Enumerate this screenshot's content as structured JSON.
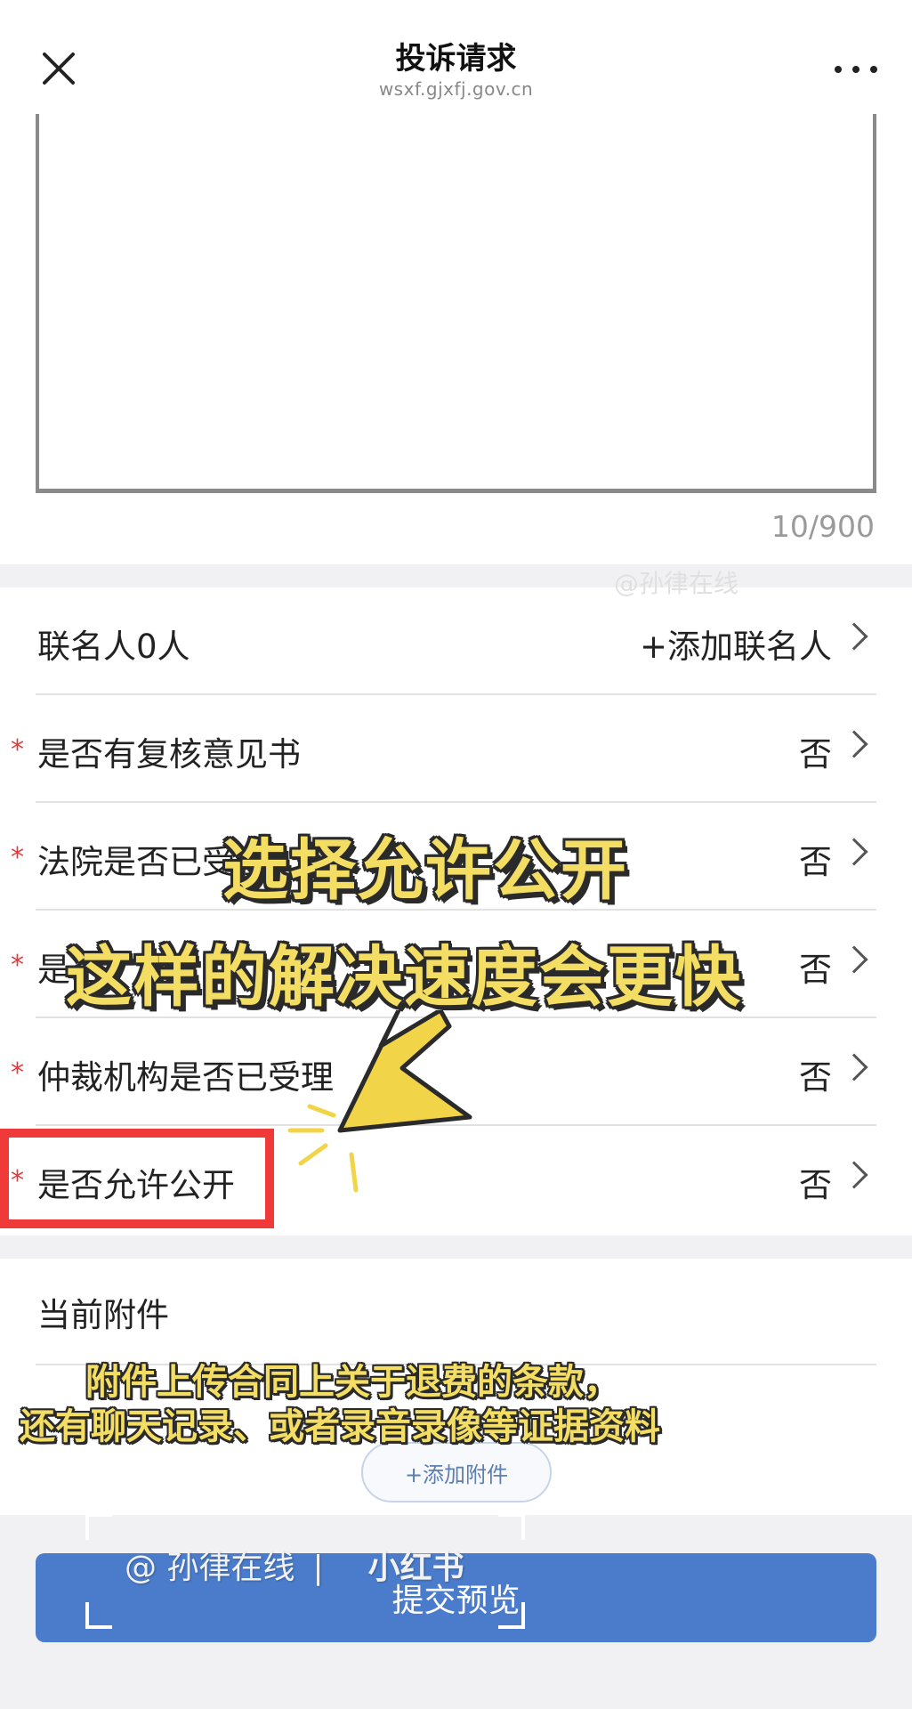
{
  "header": {
    "title": "投诉请求",
    "domain": "wsxf.gjxfj.gov.cn",
    "close_icon": "close-icon",
    "more_icon": "more-dots-icon"
  },
  "textarea": {
    "counter": "10/900"
  },
  "watermark_top": "@孙律在线",
  "form": {
    "cosigners": {
      "label": "联名人0人",
      "action": "+添加联名人"
    },
    "rows": [
      {
        "label": "是否有复核意见书",
        "value": "否",
        "required": true
      },
      {
        "label": "法院是否已受理",
        "value": "否",
        "required": true
      },
      {
        "label": "是否",
        "value": "否",
        "required": true
      },
      {
        "label": "仲裁机构是否已受理",
        "value": "否",
        "required": true
      },
      {
        "label": "是否允许公开",
        "value": "否",
        "required": true
      }
    ],
    "required_mark": "*"
  },
  "attachments": {
    "title": "当前附件",
    "add_button": "+添加附件"
  },
  "submit_button": "提交预览",
  "overlay": {
    "caption_line1": "选择允许公开",
    "caption_line2": "这样的解决速度会更快",
    "caption_line3": "附件上传合同上关于退费的条款，",
    "caption_line4": "还有聊天记录、或者录音录像等证据资料"
  },
  "bottom_watermark": {
    "account": "@ 孙律在线",
    "separator": "|",
    "brand": "小红书"
  },
  "colors": {
    "accent": "#4a7ccb",
    "required": "#e23b3b",
    "highlight_box": "#f03a3a",
    "caption": "#f3de63"
  }
}
